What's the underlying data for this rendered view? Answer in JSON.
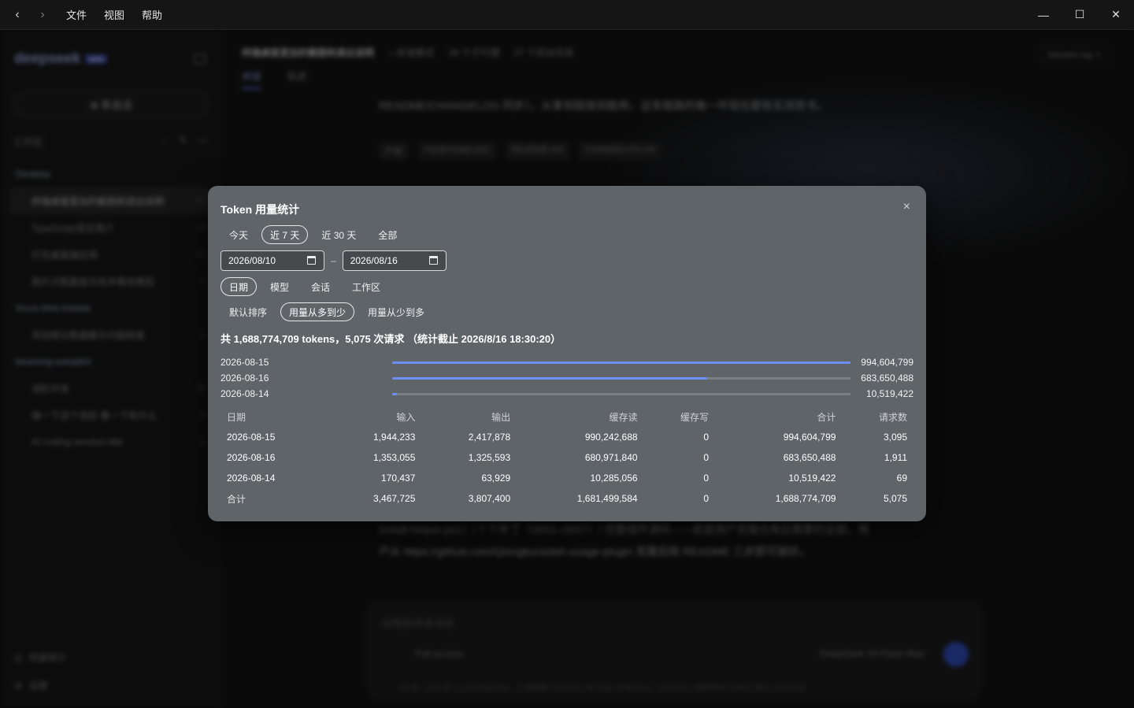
{
  "titlebar": {
    "menu": [
      "文件",
      "视图",
      "帮助"
    ],
    "back_icon": "‹",
    "forward_icon": "›",
    "minimize_icon": "—",
    "maximize_icon": "☐",
    "close_icon": "✕"
  },
  "background": {
    "logo": "deepseek",
    "badge": "beta",
    "new_chat": "⊕ 新会话",
    "section_label": "工作区",
    "sidebar_items": [
      {
        "label": "Desktop",
        "kind": "folder",
        "count": ""
      },
      {
        "label": "终端桌面里加的截图和退出说明",
        "kind": "active",
        "count": "30"
      },
      {
        "label": "TypeScript语言简介",
        "kind": "child",
        "count": "14"
      },
      {
        "label": "打包桌面端应用",
        "kind": "child",
        "count": "22"
      },
      {
        "label": "图片识图直接交给多模态模型",
        "kind": "child",
        "count": "2"
      },
      {
        "label": "focus-time-tracker",
        "kind": "folder",
        "count": ""
      },
      {
        "label": "项目跨日数据展示问题排查",
        "kind": "child",
        "count": "1"
      },
      {
        "label": "beaming-autopilot",
        "kind": "folder",
        "count": ""
      },
      {
        "label": "进阶开发",
        "kind": "child",
        "count": "35"
      },
      {
        "label": "做一下这个项目 看一下有什么",
        "kind": "child",
        "count": "1"
      },
      {
        "label": "AI coding session title",
        "kind": "child",
        "count": "1"
      }
    ],
    "footer_usage": "用量统计",
    "footer_settings": "设置",
    "main_header": [
      "终端桌面里加的截图和退出说明",
      "⌂ 标准模式",
      "26 个子代理",
      "27 个后台任务"
    ],
    "main_tabs": [
      "对话",
      "轨迹"
    ],
    "session_log": "Session log ⇩",
    "msg_top": "README/CHANGELOG 同步）。从拿到链接到能用，这条链路的每一环现在都有实测背书。",
    "chips": [
      "产物",
      "install-helper.ps1",
      "README.md",
      "CHANGELOG.md"
    ],
    "msg_bottom_1": "install-helper.ps1）/ 7 个补丁（0001–0007）/ 完整插件源码——就是用户克隆仓库后需要的全部。用",
    "msg_bottom_2": "户从 https://github.com/Qiongkura/dsh-usage-plugin 克隆后按 README 三步即可装好。",
    "composer_placeholder": "给智能体发消息",
    "composer_access": "Full access",
    "composer_model": "DeepSeek V4 Flash Max",
    "composer_meta": "58 轮 · 14.6 步 | LLM 334ms/0s · 工具调用 127ms/s | 本 token 平均 8.1s · 118 tok/s | 缓存命中 100% | 输入 112M tok"
  },
  "modal": {
    "title": "Token 用量统计",
    "close_icon": "×",
    "ranges": [
      "今天",
      "近 7 天",
      "近 30 天",
      "全部"
    ],
    "active_range": 1,
    "date_from": "2026/08/10",
    "date_to": "2026/08/16",
    "date_sep": "–",
    "groupings": [
      "日期",
      "模型",
      "会话",
      "工作区"
    ],
    "active_grouping": 0,
    "sorts": [
      "默认排序",
      "用量从多到少",
      "用量从少到多"
    ],
    "active_sort": 1,
    "summary": "共 1,688,774,709 tokens，5,075 次请求 （统计截止 2026/8/16 18:30:20）",
    "bars": [
      {
        "date": "2026-08-15",
        "value": "994,604,799",
        "fraction": 1.0
      },
      {
        "date": "2026-08-16",
        "value": "683,650,488",
        "fraction": 0.687
      },
      {
        "date": "2026-08-14",
        "value": "10,519,422",
        "fraction": 0.0106
      }
    ],
    "table": {
      "headers": [
        "日期",
        "输入",
        "输出",
        "缓存读",
        "缓存写",
        "合计",
        "请求数"
      ],
      "rows": [
        [
          "2026-08-15",
          "1,944,233",
          "2,417,878",
          "990,242,688",
          "0",
          "994,604,799",
          "3,095"
        ],
        [
          "2026-08-16",
          "1,353,055",
          "1,325,593",
          "680,971,840",
          "0",
          "683,650,488",
          "1,911"
        ],
        [
          "2026-08-14",
          "170,437",
          "63,929",
          "10,285,056",
          "0",
          "10,519,422",
          "69"
        ],
        [
          "合计",
          "3,467,725",
          "3,807,400",
          "1,681,499,584",
          "0",
          "1,688,774,709",
          "5,075"
        ]
      ]
    }
  }
}
